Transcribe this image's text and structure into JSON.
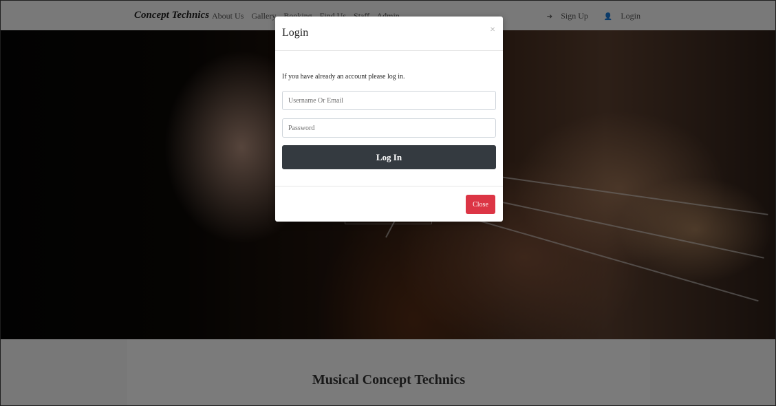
{
  "navbar": {
    "brand": "Concept Technics",
    "links": [
      "About Us",
      "Gallery",
      "Booking",
      "Find Us",
      "Staff",
      "Admin"
    ],
    "signup_label": "Sign Up",
    "login_label": "Login"
  },
  "hero": {
    "image": "guitar-hand-photo"
  },
  "content": {
    "section_title": "Musical Concept Technics"
  },
  "modal": {
    "title": "Login",
    "close_icon": "×",
    "message": "If you have already an account please log in.",
    "username_placeholder": "Username Or Email",
    "password_placeholder": "Password",
    "login_button": "Log In",
    "close_button": "Close"
  },
  "colors": {
    "login_button_bg": "#343a40",
    "close_button_bg": "#dc3545"
  }
}
